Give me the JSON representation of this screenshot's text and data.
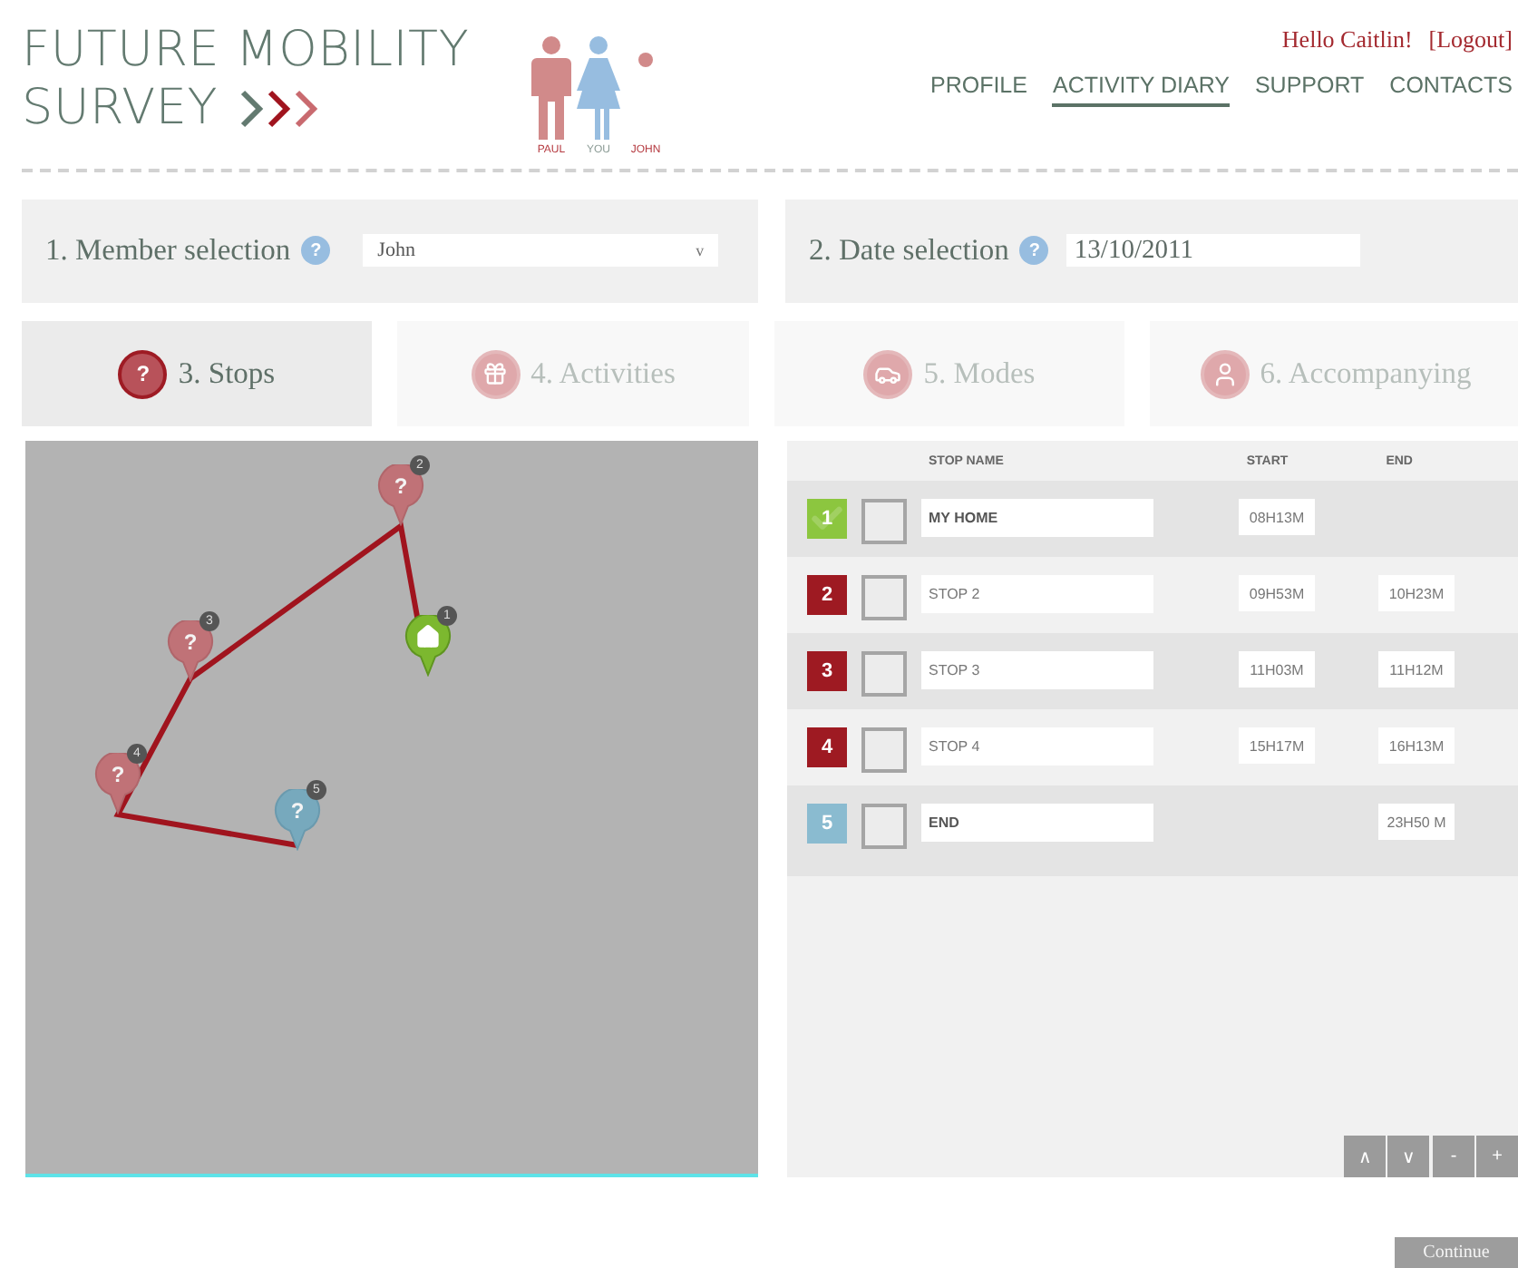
{
  "header": {
    "logo": {
      "line1": "FUTURE MOBILITY",
      "line2": "SURVEY"
    },
    "family": [
      {
        "name": "PAUL",
        "kind": "male"
      },
      {
        "name": "YOU",
        "kind": "female"
      },
      {
        "name": "JOHN",
        "kind": "dot"
      }
    ],
    "greeting": "Hello Caitlin!",
    "logout": "[Logout]",
    "nav": [
      {
        "label": "PROFILE",
        "selected": false
      },
      {
        "label": "ACTIVITY DIARY",
        "selected": true
      },
      {
        "label": "SUPPORT",
        "selected": false
      },
      {
        "label": "CONTACTS",
        "selected": false
      }
    ]
  },
  "member_selection": {
    "label": "1. Member selection",
    "help": "?",
    "value": "John",
    "caret": "v"
  },
  "date_selection": {
    "label": "2. Date selection",
    "help": "?",
    "value": "13/10/2011"
  },
  "steps": [
    {
      "label": "3. Stops",
      "selected": true,
      "kind": "question",
      "badge": "?"
    },
    {
      "label": "4. Activities",
      "selected": false,
      "kind": "gift"
    },
    {
      "label": "5. Modes",
      "selected": false,
      "kind": "car"
    },
    {
      "label": "6. Accompanying",
      "selected": false,
      "kind": "person"
    }
  ],
  "map": {
    "pins": [
      {
        "kind": "home",
        "number": "1"
      },
      {
        "kind": "stop",
        "label": "?",
        "number": "2"
      },
      {
        "kind": "stop",
        "label": "?",
        "number": "3"
      },
      {
        "kind": "stop",
        "label": "?",
        "number": "4"
      },
      {
        "kind": "end",
        "label": "?",
        "number": "5"
      }
    ]
  },
  "table": {
    "columns": [
      "STOP NAME",
      "START",
      "END"
    ],
    "rows": [
      {
        "number": "1",
        "kind": "home",
        "checked": false,
        "name": "MY HOME",
        "start": "08H13M"
      },
      {
        "number": "2",
        "kind": "stop",
        "checked": false,
        "name": "STOP 2",
        "start": "09H53M",
        "end": "10H23M"
      },
      {
        "number": "3",
        "kind": "stop",
        "checked": false,
        "name": "STOP 3",
        "start": "11H03M",
        "end": "11H12M"
      },
      {
        "number": "4",
        "kind": "stop",
        "checked": false,
        "name": "STOP 4",
        "start": "15H17M",
        "end": "16H13M"
      },
      {
        "number": "5",
        "kind": "end",
        "checked": false,
        "name": "END",
        "end": "23H50 M"
      }
    ],
    "controls": [
      "∧",
      "∨",
      "-",
      "+"
    ]
  },
  "continue_button": "Continue"
}
